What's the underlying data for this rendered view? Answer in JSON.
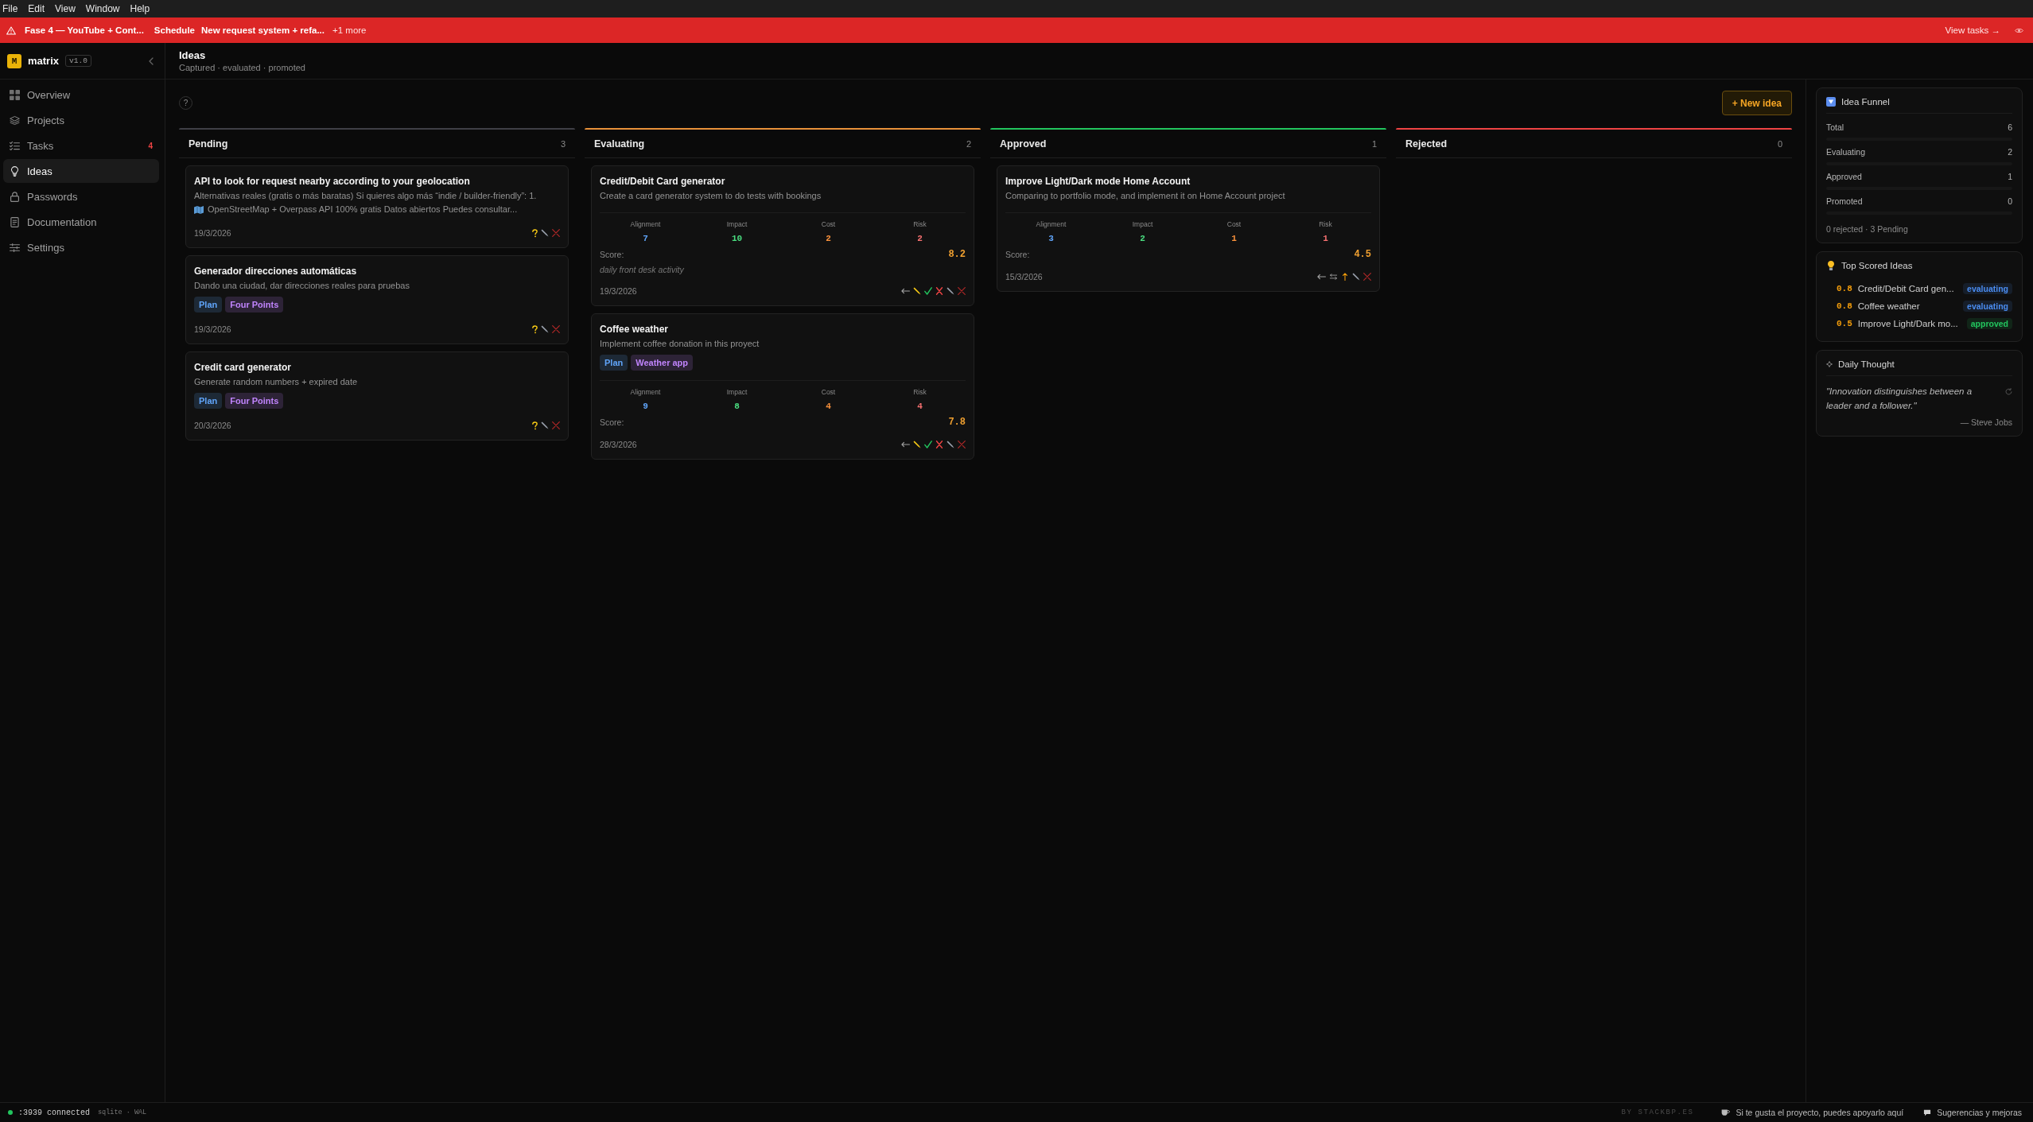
{
  "menu_bar": [
    "File",
    "Edit",
    "View",
    "Window",
    "Help"
  ],
  "banner": {
    "tasks": [
      "Fase 4 — YouTube + Cont...",
      "Schedule",
      "New request system + refa..."
    ],
    "more": "+1 more",
    "link": "View tasks →"
  },
  "sidebar": {
    "logo": "M",
    "app_name": "matrix",
    "version": "v1.0",
    "items": [
      {
        "label": "Overview",
        "selected": false
      },
      {
        "label": "Projects",
        "selected": false
      },
      {
        "label": "Tasks",
        "selected": false,
        "badge": "4"
      },
      {
        "label": "Ideas",
        "selected": true
      },
      {
        "label": "Passwords",
        "selected": false
      },
      {
        "label": "Documentation",
        "selected": false
      },
      {
        "label": "Settings",
        "selected": false
      }
    ]
  },
  "header": {
    "title": "Ideas",
    "subtitle": "Captured · evaluated · promoted"
  },
  "board": {
    "help": "?",
    "new_button": "+ New idea",
    "columns": [
      {
        "title": "Pending",
        "count": "3",
        "color": "#3f3f46",
        "ideas": [
          {
            "title": "API to look for request nearby according to your geolocation",
            "description": "Alternativas reales (gratis o más baratas) Si quieres algo más “indie / builder-friendly”: 1.",
            "description_more": "OpenStreetMap + Overpass API 100% gratis Datos abiertos Puedes consultar...",
            "date": "19/3/2026",
            "actions": [
              {
                "kind": "evaluate"
              },
              {
                "kind": "edit"
              },
              {
                "kind": "delete"
              }
            ]
          },
          {
            "title": "Generador direcciones automáticas",
            "description": "Dando una ciudad, dar direcciones reales para pruebas",
            "tags": [
              {
                "label": "Plan",
                "color": "#60a5fa"
              },
              {
                "label": "Four Points",
                "color": "#c084fc"
              }
            ],
            "date": "19/3/2026",
            "actions": [
              {
                "kind": "evaluate"
              },
              {
                "kind": "edit"
              },
              {
                "kind": "delete"
              }
            ]
          },
          {
            "title": "Credit card generator",
            "description": "Generate random numbers + expired date",
            "tags": [
              {
                "label": "Plan",
                "color": "#60a5fa"
              },
              {
                "label": "Four Points",
                "color": "#c084fc"
              }
            ],
            "date": "20/3/2026",
            "actions": [
              {
                "kind": "evaluate"
              },
              {
                "kind": "edit"
              },
              {
                "kind": "delete"
              }
            ]
          }
        ]
      },
      {
        "title": "Evaluating",
        "count": "2",
        "color": "#e8913a",
        "ideas": [
          {
            "title": "Credit/Debit Card generator",
            "description": "Create a card generator system to do tests with bookings",
            "metrics": [
              {
                "label": "Alignment",
                "value": "7",
                "color": "#60a5fa"
              },
              {
                "label": "Impact",
                "value": "10",
                "color": "#4ade80"
              },
              {
                "label": "Cost",
                "value": "2",
                "color": "#fb923c"
              },
              {
                "label": "Risk",
                "value": "2",
                "color": "#f87171"
              }
            ],
            "score_label": "Score:",
            "score": "8.2",
            "note": "daily front desk activity",
            "date": "19/3/2026",
            "actions": [
              {
                "kind": "back"
              },
              {
                "kind": "note"
              },
              {
                "kind": "approve"
              },
              {
                "kind": "reject"
              },
              {
                "kind": "edit"
              },
              {
                "kind": "delete"
              }
            ]
          },
          {
            "title": "Coffee weather",
            "description": "Implement coffee donation in this proyect",
            "tags": [
              {
                "label": "Plan",
                "color": "#60a5fa"
              },
              {
                "label": "Weather app",
                "color": "#c084fc"
              }
            ],
            "metrics": [
              {
                "label": "Alignment",
                "value": "9",
                "color": "#60a5fa"
              },
              {
                "label": "Impact",
                "value": "8",
                "color": "#4ade80"
              },
              {
                "label": "Cost",
                "value": "4",
                "color": "#fb923c"
              },
              {
                "label": "Risk",
                "value": "4",
                "color": "#f87171"
              }
            ],
            "score_label": "Score:",
            "score": "7.8",
            "date": "28/3/2026",
            "actions": [
              {
                "kind": "back"
              },
              {
                "kind": "note"
              },
              {
                "kind": "approve"
              },
              {
                "kind": "reject"
              },
              {
                "kind": "edit"
              },
              {
                "kind": "delete"
              }
            ]
          }
        ]
      },
      {
        "title": "Approved",
        "count": "1",
        "color": "#22c55e",
        "ideas": [
          {
            "title": "Improve Light/Dark mode Home Account",
            "description": "Comparing to portfolio mode, and implement it on Home Account project",
            "metrics": [
              {
                "label": "Alignment",
                "value": "3",
                "color": "#60a5fa"
              },
              {
                "label": "Impact",
                "value": "2",
                "color": "#4ade80"
              },
              {
                "label": "Cost",
                "value": "1",
                "color": "#fb923c"
              },
              {
                "label": "Risk",
                "value": "1",
                "color": "#f87171"
              }
            ],
            "score_label": "Score:",
            "score": "4.5",
            "date": "15/3/2026",
            "actions": [
              {
                "kind": "back"
              },
              {
                "kind": "swap"
              },
              {
                "kind": "promote"
              },
              {
                "kind": "edit"
              },
              {
                "kind": "delete"
              }
            ]
          }
        ]
      },
      {
        "title": "Rejected",
        "count": "0",
        "color": "#ef4444"
      }
    ]
  },
  "right_panel": {
    "funnel": {
      "title": "Idea Funnel",
      "rows": [
        {
          "label": "Total",
          "value": "6"
        },
        {
          "label": "Evaluating",
          "value": "2"
        },
        {
          "label": "Approved",
          "value": "1"
        },
        {
          "label": "Promoted",
          "value": "0"
        }
      ],
      "footer": "0 rejected · 3 Pending"
    },
    "top_scored": {
      "title": "Top Scored Ideas",
      "items": [
        {
          "score": "0.8",
          "name": "Credit/Debit Card gen...",
          "status": "evaluating",
          "color": "#4a8cf0"
        },
        {
          "score": "0.8",
          "name": "Coffee weather",
          "status": "evaluating",
          "color": "#4a8cf0"
        },
        {
          "score": "0.5",
          "name": "Improve Light/Dark mo...",
          "status": "approved",
          "color": "#22c55e"
        }
      ]
    },
    "daily_thought": {
      "title": "Daily Thought",
      "quote": "\"Innovation distinguishes between a leader and a follower.\"",
      "author": "— Steve Jobs"
    }
  },
  "status_bar": {
    "connected": true,
    "port": ":3939 connected",
    "db": "sqlite · WAL",
    "credit": "BY STACKBP.ES",
    "support": "Si te gusta el proyecto, puedes apoyarlo aquí",
    "feedback": "Sugerencias y mejoras"
  }
}
